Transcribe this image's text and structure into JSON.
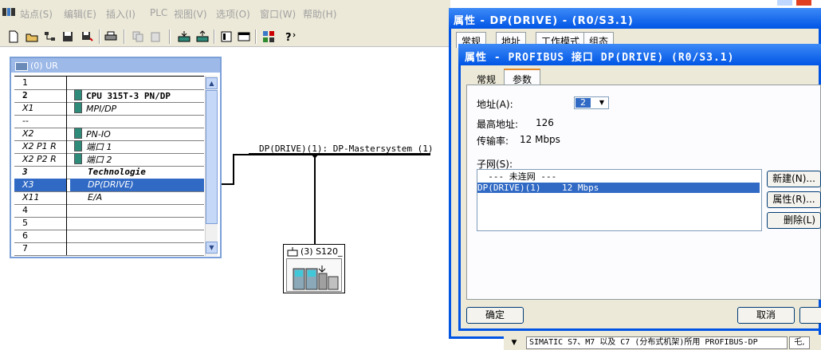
{
  "menubar": {
    "items": [
      "站点(S)",
      "编辑(E)",
      "插入(I)",
      "PLC",
      "视图(V)",
      "选项(O)",
      "窗口(W)",
      "帮助(H)"
    ]
  },
  "rack": {
    "title": "(0) UR",
    "rows": [
      {
        "slot": "1",
        "module": ""
      },
      {
        "slot": "2",
        "module": "CPU 315T-3 PN/DP"
      },
      {
        "slot": "X1",
        "module": "MPI/DP"
      },
      {
        "slot": "--",
        "module": ""
      },
      {
        "slot": "X2",
        "module": "PN-IO"
      },
      {
        "slot": "X2 P1 R",
        "module": "端口 1"
      },
      {
        "slot": "X2 P2 R",
        "module": "端口 2"
      },
      {
        "slot": "3",
        "module": "Technologie"
      },
      {
        "slot": "X3",
        "module": "DP(DRIVE)"
      },
      {
        "slot": "X11",
        "module": "E/A"
      },
      {
        "slot": "4",
        "module": ""
      },
      {
        "slot": "5",
        "module": ""
      },
      {
        "slot": "6",
        "module": ""
      },
      {
        "slot": "7",
        "module": ""
      }
    ]
  },
  "network": {
    "label": "DP(DRIVE)(1): DP-Mastersystem (1)"
  },
  "device": {
    "label": "(3) S120_"
  },
  "dialog_outer": {
    "title": "属性 - DP(DRIVE) - (R0/S3.1)",
    "tabs": [
      "常规",
      "地址",
      "工作模式",
      "组态"
    ]
  },
  "dialog_inner": {
    "title": "属性 - PROFIBUS 接口  DP(DRIVE) (R0/S3.1)",
    "tabs": [
      "常规",
      "参数"
    ],
    "active_tab": "参数",
    "address_label": "地址(A):",
    "address_value": "2",
    "highest_label": "最高地址:",
    "highest_value": "126",
    "rate_label": "传输率:",
    "rate_value": "12 Mbps",
    "subnet_label": "子网(S):",
    "subnets": [
      "  --- 未连网 ---",
      "DP(DRIVE)(1)    12 Mbps"
    ],
    "buttons": {
      "new": "新建(N)...",
      "properties": "属性(R)...",
      "delete": "删除(L)"
    },
    "ok": "确定",
    "cancel": "取消"
  },
  "statusbar": {
    "text": "SIMATIC S7、M7 以及 C7 (分布式机架)所用 PROFIBUS-DP",
    "ime": "乇,"
  }
}
